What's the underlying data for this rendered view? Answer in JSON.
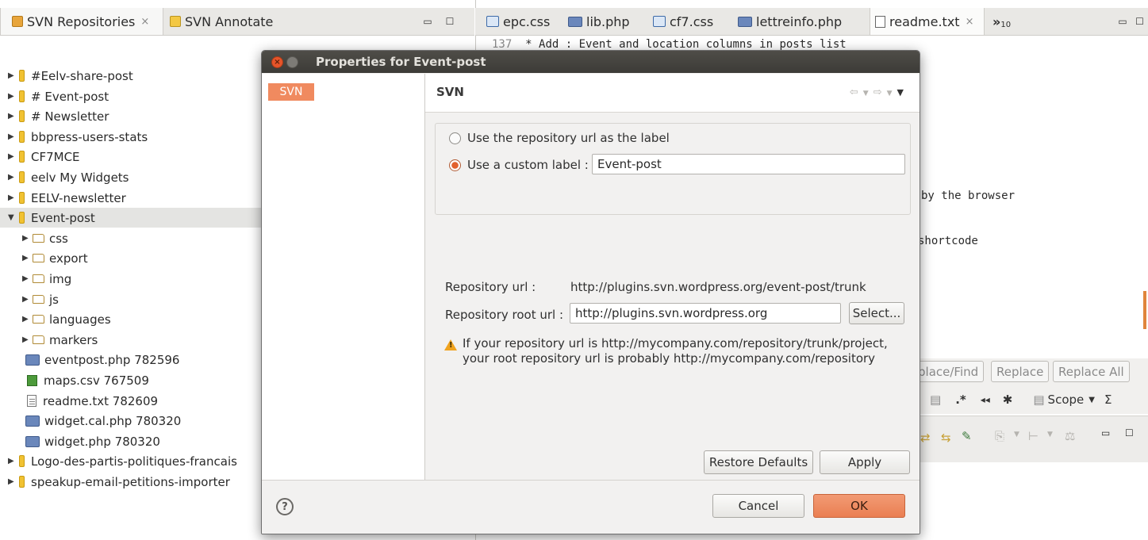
{
  "left_view": {
    "tabs": [
      {
        "label": "SVN Repositories",
        "close": "×"
      },
      {
        "label": "SVN Annotate"
      }
    ],
    "window_controls": {
      "minimize": "▭",
      "maximize": "☐"
    },
    "tree": [
      {
        "label": "#Eelv-share-post",
        "kind": "project",
        "expanded": false
      },
      {
        "label": "# Event-post",
        "kind": "project",
        "expanded": false
      },
      {
        "label": "# Newsletter",
        "kind": "project",
        "expanded": false
      },
      {
        "label": "bbpress-users-stats",
        "kind": "project",
        "expanded": false
      },
      {
        "label": "CF7MCE",
        "kind": "project",
        "expanded": false
      },
      {
        "label": "eelv My Widgets",
        "kind": "project",
        "expanded": false
      },
      {
        "label": "EELV-newsletter",
        "kind": "project",
        "expanded": false
      },
      {
        "label": "Event-post",
        "kind": "project",
        "expanded": true,
        "selected": true
      },
      {
        "label": "css",
        "kind": "folder",
        "expanded": false
      },
      {
        "label": "export",
        "kind": "folder",
        "expanded": false
      },
      {
        "label": "img",
        "kind": "folder",
        "expanded": false
      },
      {
        "label": "js",
        "kind": "folder",
        "expanded": false
      },
      {
        "label": "languages",
        "kind": "folder",
        "expanded": false
      },
      {
        "label": "markers",
        "kind": "folder",
        "expanded": false
      },
      {
        "label": "eventpost.php 782596",
        "kind": "php"
      },
      {
        "label": "maps.csv 767509",
        "kind": "csv"
      },
      {
        "label": "readme.txt 782609",
        "kind": "txt"
      },
      {
        "label": "widget.cal.php 780320",
        "kind": "php"
      },
      {
        "label": "widget.php 780320",
        "kind": "php"
      },
      {
        "label": "Logo-des-partis-politiques-francais",
        "kind": "project",
        "expanded": false
      },
      {
        "label": "speakup-email-petitions-importer",
        "kind": "project",
        "expanded": false
      }
    ]
  },
  "editor": {
    "tabs": [
      {
        "label": "epc.css",
        "icon": "css-file-icon"
      },
      {
        "label": "lib.php",
        "icon": "php-file-icon"
      },
      {
        "label": "cf7.css",
        "icon": "css-file-icon"
      },
      {
        "label": "lettreinfo.php",
        "icon": "php-file-icon"
      },
      {
        "label": "readme.txt",
        "icon": "text-file-icon",
        "active": true,
        "close": "×"
      }
    ],
    "overflow_label": "»",
    "overflow_count": "10",
    "line_number": "137",
    "line_text": "* Add : Event and location columns in posts list",
    "visible_fragments": [
      "by the browser",
      "shortcode"
    ],
    "find_buttons": [
      "place/Find",
      "Replace",
      "Replace All"
    ],
    "scope_label": "Scope"
  },
  "dialog": {
    "title": "Properties for Event-post",
    "nav_items": [
      "SVN"
    ],
    "page_title": "SVN",
    "label_options": {
      "repo_url_option": "Use the repository url as the label",
      "custom_option": "Use a custom label :",
      "custom_value": "Event-post",
      "selected": "custom"
    },
    "repository_url_label": "Repository url :",
    "repository_url_value": "http://plugins.svn.wordpress.org/event-post/trunk",
    "root_url_label": "Repository root url :",
    "root_url_value": "http://plugins.svn.wordpress.org",
    "select_button": "Select...",
    "warning_line1": "If your repository url is http://mycompany.com/repository/trunk/project,",
    "warning_line2": "your root repository url is probably http://mycompany.com/repository",
    "restore_defaults": "Restore Defaults",
    "apply": "Apply",
    "cancel": "Cancel",
    "ok": "OK"
  },
  "colors": {
    "accent": "#ea7f52",
    "titlebar": "#3c3b37",
    "selection": "#e4e4e2"
  }
}
